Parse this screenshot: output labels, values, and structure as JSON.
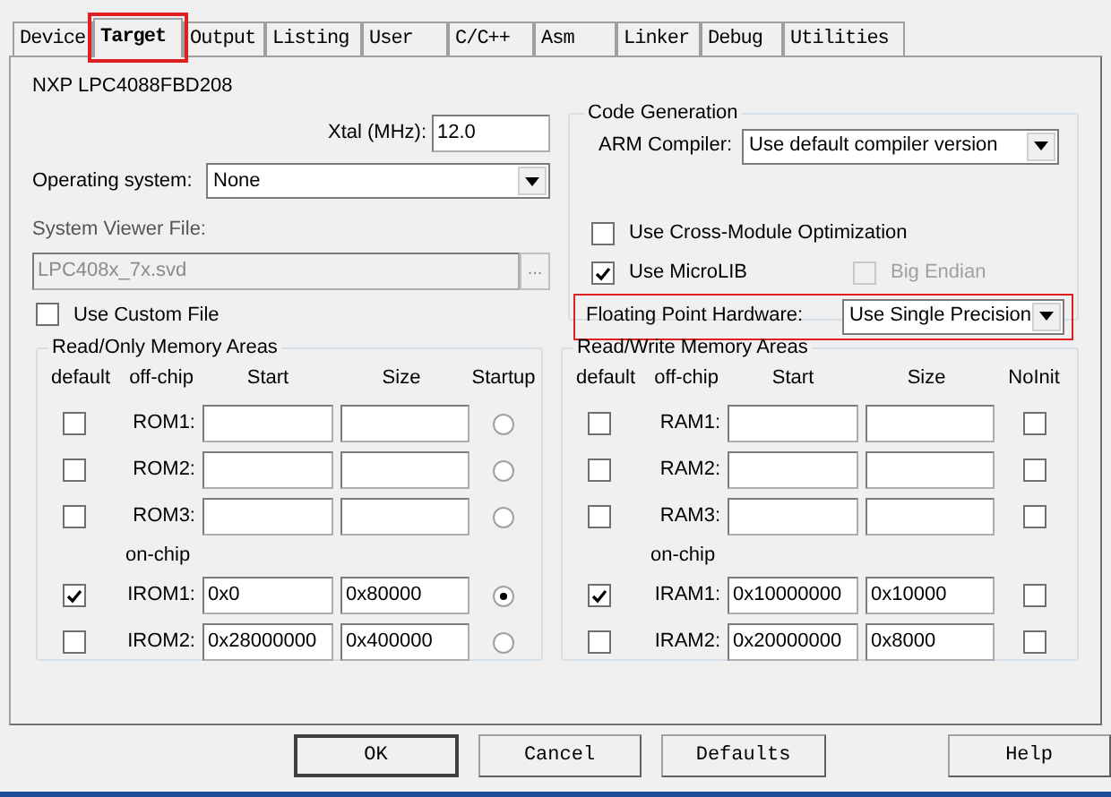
{
  "tabs": [
    {
      "label": "Device",
      "selected": false,
      "highlighted": false
    },
    {
      "label": "Target",
      "selected": true,
      "highlighted": true
    },
    {
      "label": "Output",
      "selected": false,
      "highlighted": false
    },
    {
      "label": "Listing",
      "selected": false,
      "highlighted": false
    },
    {
      "label": "User",
      "selected": false,
      "highlighted": false
    },
    {
      "label": "C/C++",
      "selected": false,
      "highlighted": false
    },
    {
      "label": "Asm",
      "selected": false,
      "highlighted": false
    },
    {
      "label": "Linker",
      "selected": false,
      "highlighted": false
    },
    {
      "label": "Debug",
      "selected": false,
      "highlighted": false
    },
    {
      "label": "Utilities",
      "selected": false,
      "highlighted": false
    }
  ],
  "device": "NXP LPC4088FBD208",
  "xtal": {
    "label": "Xtal (MHz):",
    "value": "12.0"
  },
  "os": {
    "label": "Operating system:",
    "value": "None"
  },
  "svd": {
    "label": "System Viewer File:",
    "value": "LPC408x_7x.svd",
    "disabled": true,
    "browse": "..."
  },
  "custom_file": {
    "label": "Use Custom File",
    "checked": false
  },
  "code_gen": {
    "title": "Code Generation",
    "compiler_label": "ARM Compiler:",
    "compiler": "Use default compiler version",
    "options": [
      {
        "label": "Use Cross-Module Optimization",
        "checked": false,
        "disabled": false
      },
      {
        "label": "Use MicroLIB",
        "checked": true,
        "disabled": false
      },
      {
        "label": "Big Endian",
        "checked": false,
        "disabled": true
      }
    ],
    "fpu_label": "Floating Point Hardware:",
    "fpu": "Use Single Precision",
    "fpu_highlighted": true
  },
  "rom": {
    "title": "Read/Only Memory Areas",
    "headers": [
      "default",
      "off-chip",
      "Start",
      "Size",
      "Startup"
    ],
    "on_chip_label": "on-chip",
    "off_chip_rows": [
      {
        "default": false,
        "label": "ROM1:",
        "selected": false
      },
      {
        "default": false,
        "label": "ROM2:",
        "selected": false
      },
      {
        "default": false,
        "label": "ROM3:",
        "selected": false
      }
    ],
    "on_chip_rows": [
      {
        "default": true,
        "label": "IROM1:",
        "start": "0x0",
        "size": "0x80000",
        "selected": true
      },
      {
        "default": false,
        "label": "IROM2:",
        "start": "0x28000000",
        "size": "0x400000",
        "selected": false
      }
    ]
  },
  "ram": {
    "title": "Read/Write Memory Areas",
    "headers": [
      "default",
      "off-chip",
      "Start",
      "Size",
      "NoInit"
    ],
    "on_chip_label": "on-chip",
    "off_chip_rows": [
      {
        "default": false,
        "label": "RAM1:",
        "noinit": false
      },
      {
        "default": false,
        "label": "RAM2:",
        "noinit": false
      },
      {
        "default": false,
        "label": "RAM3:",
        "noinit": false
      }
    ],
    "on_chip_rows": [
      {
        "default": true,
        "label": "IRAM1:",
        "start": "0x10000000",
        "size": "0x10000",
        "noinit": false
      },
      {
        "default": false,
        "label": "IRAM2:",
        "start": "0x20000000",
        "size": "0x8000",
        "noinit": false
      }
    ]
  },
  "buttons": [
    {
      "label": "OK",
      "default": true
    },
    {
      "label": "Cancel",
      "default": false
    },
    {
      "label": "Defaults",
      "default": false
    },
    {
      "label": "Help",
      "default": false
    }
  ]
}
